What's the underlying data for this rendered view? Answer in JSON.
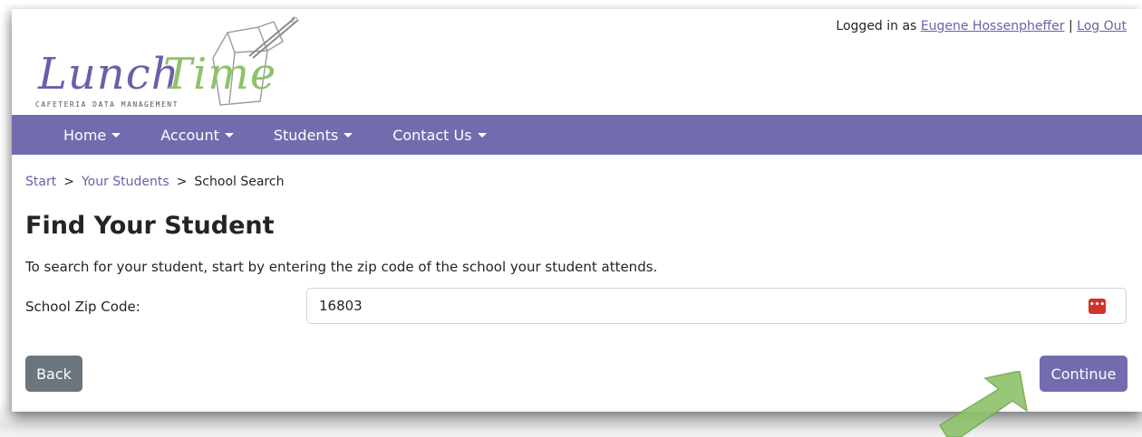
{
  "logo": {
    "word1": "Lunch",
    "word2": "Time",
    "subtitle": "CAFETERIA DATA MANAGEMENT",
    "word1_color": "#6a5fa8",
    "word2_color": "#8dc26a"
  },
  "header": {
    "logged_in_prefix": "Logged in as",
    "user_name": "Eugene Hossenpheffer",
    "separator": "|",
    "logout_label": "Log Out"
  },
  "nav": {
    "background": "#726cae",
    "items": [
      {
        "label": "Home"
      },
      {
        "label": "Account"
      },
      {
        "label": "Students"
      },
      {
        "label": "Contact Us"
      }
    ]
  },
  "breadcrumb": {
    "start": "Start",
    "your_students": "Your Students",
    "current": "School Search",
    "separator": ">"
  },
  "main": {
    "title": "Find Your Student",
    "instructions": "To search for your student, start by entering the zip code of the school your student attends.",
    "zip_label": "School Zip Code:",
    "zip_value": "16803",
    "password_manager_icon": "password-manager-icon"
  },
  "buttons": {
    "back_label": "Back",
    "continue_label": "Continue",
    "back_color": "#6c757d",
    "continue_color": "#726cae"
  },
  "annotation": {
    "arrow_color": "#8dc26a",
    "arrow_icon": "pointer-arrow-icon"
  }
}
